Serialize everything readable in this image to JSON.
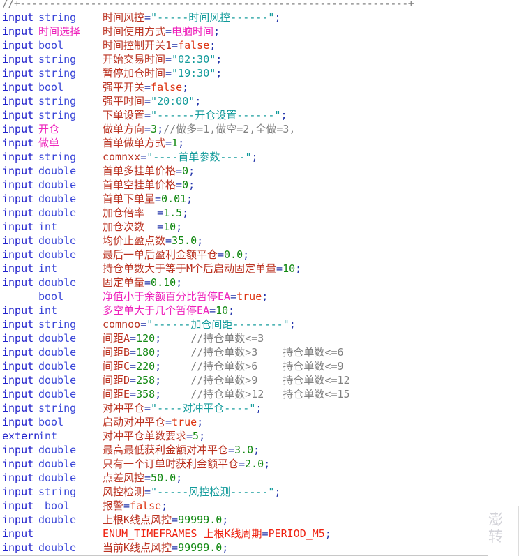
{
  "editor": {
    "language": "MQL4",
    "banner_comment": "//+------------------------------------------------------------------+",
    "colors": {
      "keyword": "#2222cc",
      "type": "#3a46d8",
      "user_type": "#ee22bb",
      "identifier": "#bb3322",
      "operator": "#2233aa",
      "string": "#119a9a",
      "number": "#118811",
      "boolean": "#dd3311",
      "constant": "#ee2211",
      "comment": "#808080",
      "background": "#ffffff"
    }
  },
  "watermark": {
    "line1": "澎",
    "line2": "转"
  },
  "lines": [
    {
      "keyword": "input",
      "type": "string",
      "type_class": "t-type",
      "name": "时间风控",
      "op": "=",
      "value": "\"-----时间风控------\"",
      "value_class": "t-str",
      "end": ";",
      "comment": ""
    },
    {
      "keyword": "input",
      "type": "时间选择",
      "type_class": "t-utype",
      "name": "时间使用方式",
      "op": "=",
      "value": "电脑时间",
      "value_class": "t-enumval",
      "end": ";",
      "comment": ""
    },
    {
      "keyword": "input",
      "type": "bool",
      "type_class": "t-type",
      "name": "时间控制开关1",
      "op": "=",
      "value": "false",
      "value_class": "t-bool",
      "end": ";",
      "comment": ""
    },
    {
      "keyword": "input",
      "type": "string",
      "type_class": "t-type",
      "name": "开始交易时间",
      "op": "=",
      "value": "\"02:30\"",
      "value_class": "t-str",
      "end": ";",
      "comment": ""
    },
    {
      "keyword": "input",
      "type": "string",
      "type_class": "t-type",
      "name": "暂停加仓时间",
      "op": "=",
      "value": "\"19:30\"",
      "value_class": "t-str",
      "end": ";",
      "comment": ""
    },
    {
      "keyword": "input",
      "type": "bool",
      "type_class": "t-type",
      "name": "强平开关",
      "op": "=",
      "value": "false",
      "value_class": "t-bool",
      "end": ";",
      "comment": ""
    },
    {
      "keyword": "input",
      "type": "string",
      "type_class": "t-type",
      "name": "强平时间",
      "op": "=",
      "value": "\"20:00\"",
      "value_class": "t-str",
      "end": ";",
      "comment": ""
    },
    {
      "keyword": "input",
      "type": "string",
      "type_class": "t-type",
      "name": "下单设置",
      "op": "=",
      "value": "\"------开仓设置------\"",
      "value_class": "t-str",
      "end": ";",
      "comment": ""
    },
    {
      "keyword": "input",
      "type": "开仓",
      "type_class": "t-utype",
      "name": "做单方向",
      "op": "=",
      "value": "3",
      "value_class": "t-num",
      "end": ";",
      "comment": "//做多=1,做空=2,全做=3,"
    },
    {
      "keyword": "input",
      "type": "做单",
      "type_class": "t-utype",
      "name": "首单做单方式",
      "op": "=",
      "value": "1",
      "value_class": "t-num",
      "end": ";",
      "comment": ""
    },
    {
      "keyword": "input",
      "type": "string",
      "type_class": "t-type",
      "name": "comnxx",
      "op": "=",
      "value": "\"----首单参数----\"",
      "value_class": "t-str",
      "end": ";",
      "comment": ""
    },
    {
      "keyword": "input",
      "type": "double",
      "type_class": "t-type",
      "name": "首单多挂单价格",
      "op": "=",
      "value": "0",
      "value_class": "t-num",
      "end": ";",
      "comment": ""
    },
    {
      "keyword": "input",
      "type": "double",
      "type_class": "t-type",
      "name": "首单空挂单价格",
      "op": "=",
      "value": "0",
      "value_class": "t-num",
      "end": ";",
      "comment": ""
    },
    {
      "keyword": "input",
      "type": "double",
      "type_class": "t-type",
      "name": "首单下单量",
      "op": "=",
      "value": "0.01",
      "value_class": "t-num",
      "end": ";",
      "comment": ""
    },
    {
      "keyword": "input",
      "type": "double",
      "type_class": "t-type",
      "name": "加仓倍率  ",
      "op": "=",
      "value": "1.5",
      "value_class": "t-num",
      "end": ";",
      "comment": ""
    },
    {
      "keyword": "input",
      "type": "int",
      "type_class": "t-type",
      "name": "加仓次数  ",
      "op": "=",
      "value": "10",
      "value_class": "t-num",
      "end": ";",
      "comment": ""
    },
    {
      "keyword": "input",
      "type": "double",
      "type_class": "t-type",
      "name": "均价止盈点数",
      "op": "=",
      "value": "35.0",
      "value_class": "t-num",
      "end": ";",
      "comment": ""
    },
    {
      "keyword": "input",
      "type": "double",
      "type_class": "t-type",
      "name": "最后一单后盈利金额平仓",
      "op": "=",
      "value": "0.0",
      "value_class": "t-num",
      "end": ";",
      "comment": ""
    },
    {
      "keyword": "input",
      "type": "int",
      "type_class": "t-type",
      "name": "持仓单数大于等于M个后启动固定单量",
      "op": "=",
      "value": "10",
      "value_class": "t-num",
      "end": ";",
      "comment": ""
    },
    {
      "keyword": "input",
      "type": "double",
      "type_class": "t-type",
      "name": "固定单量",
      "op": "=",
      "value": "0.10",
      "value_class": "t-num",
      "end": ";",
      "comment": ""
    },
    {
      "keyword": "",
      "type": "bool",
      "type_class": "t-type",
      "name": "净值小于余额百分比暂停EA",
      "name_class": "t-name-pk",
      "op": "=",
      "value": "true",
      "value_class": "t-bool",
      "end": ";",
      "comment": ""
    },
    {
      "keyword": "input",
      "type": "int",
      "type_class": "t-type",
      "name": "多空单大于几个暂停EA",
      "name_class": "t-name-pk",
      "op": "=",
      "value": "10",
      "value_class": "t-num",
      "end": ";",
      "comment": ""
    },
    {
      "keyword": "input",
      "type": "string",
      "type_class": "t-type",
      "name": "comnoo",
      "op": "=",
      "value": "\"------加仓间距--------\"",
      "value_class": "t-str",
      "end": ";",
      "comment": ""
    },
    {
      "keyword": "input",
      "type": "double",
      "type_class": "t-type",
      "name": "间距A",
      "op": "=",
      "value": "120",
      "value_class": "t-num",
      "end": ";",
      "comment": "//持仓单数<=3"
    },
    {
      "keyword": "input",
      "type": "double",
      "type_class": "t-type",
      "name": "间距B",
      "op": "=",
      "value": "180",
      "value_class": "t-num",
      "end": ";",
      "comment": "//持仓单数>3    持仓单数<=6"
    },
    {
      "keyword": "input",
      "type": "double",
      "type_class": "t-type",
      "name": "间距C",
      "op": "=",
      "value": "220",
      "value_class": "t-num",
      "end": ";",
      "comment": "//持仓单数>6    持仓单数<=9"
    },
    {
      "keyword": "input",
      "type": "double",
      "type_class": "t-type",
      "name": "间距D",
      "op": "=",
      "value": "258",
      "value_class": "t-num",
      "end": ";",
      "comment": "//持仓单数>9    持仓单数<=12"
    },
    {
      "keyword": "input",
      "type": "double",
      "type_class": "t-type",
      "name": "间距E",
      "op": "=",
      "value": "358",
      "value_class": "t-num",
      "end": ";",
      "comment": "//持仓单数>12   持仓单数<=15"
    },
    {
      "keyword": "input",
      "type": "string",
      "type_class": "t-type",
      "name": "对冲平仓",
      "op": "=",
      "value": "\"----对冲平仓----\"",
      "value_class": "t-str",
      "end": ";",
      "comment": ""
    },
    {
      "keyword": "input",
      "type": "bool",
      "type_class": "t-type",
      "name": "启动对冲平仓",
      "op": "=",
      "value": "true",
      "value_class": "t-bool",
      "end": ";",
      "comment": ""
    },
    {
      "keyword": "extern",
      "type": "int",
      "type_class": "t-type",
      "name": "对冲平仓单数要求",
      "op": "=",
      "value": "5",
      "value_class": "t-num",
      "end": ";",
      "comment": ""
    },
    {
      "keyword": "input",
      "type": "double",
      "type_class": "t-type",
      "name": "最高最低获利金额对冲平仓",
      "op": "=",
      "value": "3.0",
      "value_class": "t-num",
      "end": ";",
      "comment": ""
    },
    {
      "keyword": "input",
      "type": "double",
      "type_class": "t-type",
      "name": "只有一个订单时获利金额平仓",
      "op": "=",
      "value": "2.0",
      "value_class": "t-num",
      "end": ";",
      "comment": ""
    },
    {
      "keyword": "input",
      "type": "double",
      "type_class": "t-type",
      "name": "点差风控",
      "op": "=",
      "value": "50.0",
      "value_class": "t-num",
      "end": ";",
      "comment": ""
    },
    {
      "keyword": "input",
      "type": "string",
      "type_class": "t-type",
      "name": "风控检测",
      "op": "=",
      "value": "\"-----风控检测------\"",
      "value_class": "t-str",
      "end": ";",
      "comment": ""
    },
    {
      "keyword": "input",
      "type": " bool",
      "type_class": "t-type",
      "name": "报警",
      "op": "=",
      "value": "false",
      "value_class": "t-bool",
      "end": ";",
      "comment": ""
    },
    {
      "keyword": "input",
      "type": "double",
      "type_class": "t-type",
      "name": "上根K线点风控",
      "op": "=",
      "value": "99999.0",
      "value_class": "t-num",
      "end": ";",
      "comment": ""
    },
    {
      "keyword": "input",
      "type": "",
      "type_class": "t-type",
      "name": "ENUM_TIMEFRAMES 上根K线周期",
      "name_class": "t-const",
      "op": "=",
      "value": "PERIOD_M5",
      "value_class": "t-const",
      "end": ";",
      "comment": ""
    },
    {
      "keyword": "input",
      "type": "double",
      "type_class": "t-type",
      "name": "当前K线点风控",
      "op": "=",
      "value": "99999.0",
      "value_class": "t-num",
      "end": ";",
      "comment": ""
    }
  ]
}
